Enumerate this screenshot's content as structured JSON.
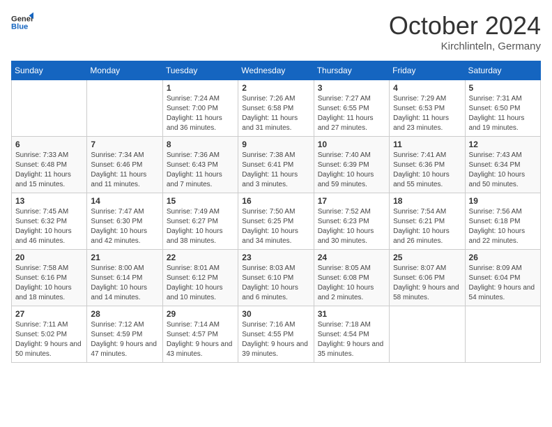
{
  "header": {
    "logo_general": "General",
    "logo_blue": "Blue",
    "month_title": "October 2024",
    "location": "Kirchlinteln, Germany"
  },
  "calendar": {
    "days_of_week": [
      "Sunday",
      "Monday",
      "Tuesday",
      "Wednesday",
      "Thursday",
      "Friday",
      "Saturday"
    ],
    "weeks": [
      [
        {
          "day": null,
          "sunrise": null,
          "sunset": null,
          "daylight": null
        },
        {
          "day": null,
          "sunrise": null,
          "sunset": null,
          "daylight": null
        },
        {
          "day": "1",
          "sunrise": "Sunrise: 7:24 AM",
          "sunset": "Sunset: 7:00 PM",
          "daylight": "Daylight: 11 hours and 36 minutes."
        },
        {
          "day": "2",
          "sunrise": "Sunrise: 7:26 AM",
          "sunset": "Sunset: 6:58 PM",
          "daylight": "Daylight: 11 hours and 31 minutes."
        },
        {
          "day": "3",
          "sunrise": "Sunrise: 7:27 AM",
          "sunset": "Sunset: 6:55 PM",
          "daylight": "Daylight: 11 hours and 27 minutes."
        },
        {
          "day": "4",
          "sunrise": "Sunrise: 7:29 AM",
          "sunset": "Sunset: 6:53 PM",
          "daylight": "Daylight: 11 hours and 23 minutes."
        },
        {
          "day": "5",
          "sunrise": "Sunrise: 7:31 AM",
          "sunset": "Sunset: 6:50 PM",
          "daylight": "Daylight: 11 hours and 19 minutes."
        }
      ],
      [
        {
          "day": "6",
          "sunrise": "Sunrise: 7:33 AM",
          "sunset": "Sunset: 6:48 PM",
          "daylight": "Daylight: 11 hours and 15 minutes."
        },
        {
          "day": "7",
          "sunrise": "Sunrise: 7:34 AM",
          "sunset": "Sunset: 6:46 PM",
          "daylight": "Daylight: 11 hours and 11 minutes."
        },
        {
          "day": "8",
          "sunrise": "Sunrise: 7:36 AM",
          "sunset": "Sunset: 6:43 PM",
          "daylight": "Daylight: 11 hours and 7 minutes."
        },
        {
          "day": "9",
          "sunrise": "Sunrise: 7:38 AM",
          "sunset": "Sunset: 6:41 PM",
          "daylight": "Daylight: 11 hours and 3 minutes."
        },
        {
          "day": "10",
          "sunrise": "Sunrise: 7:40 AM",
          "sunset": "Sunset: 6:39 PM",
          "daylight": "Daylight: 10 hours and 59 minutes."
        },
        {
          "day": "11",
          "sunrise": "Sunrise: 7:41 AM",
          "sunset": "Sunset: 6:36 PM",
          "daylight": "Daylight: 10 hours and 55 minutes."
        },
        {
          "day": "12",
          "sunrise": "Sunrise: 7:43 AM",
          "sunset": "Sunset: 6:34 PM",
          "daylight": "Daylight: 10 hours and 50 minutes."
        }
      ],
      [
        {
          "day": "13",
          "sunrise": "Sunrise: 7:45 AM",
          "sunset": "Sunset: 6:32 PM",
          "daylight": "Daylight: 10 hours and 46 minutes."
        },
        {
          "day": "14",
          "sunrise": "Sunrise: 7:47 AM",
          "sunset": "Sunset: 6:30 PM",
          "daylight": "Daylight: 10 hours and 42 minutes."
        },
        {
          "day": "15",
          "sunrise": "Sunrise: 7:49 AM",
          "sunset": "Sunset: 6:27 PM",
          "daylight": "Daylight: 10 hours and 38 minutes."
        },
        {
          "day": "16",
          "sunrise": "Sunrise: 7:50 AM",
          "sunset": "Sunset: 6:25 PM",
          "daylight": "Daylight: 10 hours and 34 minutes."
        },
        {
          "day": "17",
          "sunrise": "Sunrise: 7:52 AM",
          "sunset": "Sunset: 6:23 PM",
          "daylight": "Daylight: 10 hours and 30 minutes."
        },
        {
          "day": "18",
          "sunrise": "Sunrise: 7:54 AM",
          "sunset": "Sunset: 6:21 PM",
          "daylight": "Daylight: 10 hours and 26 minutes."
        },
        {
          "day": "19",
          "sunrise": "Sunrise: 7:56 AM",
          "sunset": "Sunset: 6:18 PM",
          "daylight": "Daylight: 10 hours and 22 minutes."
        }
      ],
      [
        {
          "day": "20",
          "sunrise": "Sunrise: 7:58 AM",
          "sunset": "Sunset: 6:16 PM",
          "daylight": "Daylight: 10 hours and 18 minutes."
        },
        {
          "day": "21",
          "sunrise": "Sunrise: 8:00 AM",
          "sunset": "Sunset: 6:14 PM",
          "daylight": "Daylight: 10 hours and 14 minutes."
        },
        {
          "day": "22",
          "sunrise": "Sunrise: 8:01 AM",
          "sunset": "Sunset: 6:12 PM",
          "daylight": "Daylight: 10 hours and 10 minutes."
        },
        {
          "day": "23",
          "sunrise": "Sunrise: 8:03 AM",
          "sunset": "Sunset: 6:10 PM",
          "daylight": "Daylight: 10 hours and 6 minutes."
        },
        {
          "day": "24",
          "sunrise": "Sunrise: 8:05 AM",
          "sunset": "Sunset: 6:08 PM",
          "daylight": "Daylight: 10 hours and 2 minutes."
        },
        {
          "day": "25",
          "sunrise": "Sunrise: 8:07 AM",
          "sunset": "Sunset: 6:06 PM",
          "daylight": "Daylight: 9 hours and 58 minutes."
        },
        {
          "day": "26",
          "sunrise": "Sunrise: 8:09 AM",
          "sunset": "Sunset: 6:04 PM",
          "daylight": "Daylight: 9 hours and 54 minutes."
        }
      ],
      [
        {
          "day": "27",
          "sunrise": "Sunrise: 7:11 AM",
          "sunset": "Sunset: 5:02 PM",
          "daylight": "Daylight: 9 hours and 50 minutes."
        },
        {
          "day": "28",
          "sunrise": "Sunrise: 7:12 AM",
          "sunset": "Sunset: 4:59 PM",
          "daylight": "Daylight: 9 hours and 47 minutes."
        },
        {
          "day": "29",
          "sunrise": "Sunrise: 7:14 AM",
          "sunset": "Sunset: 4:57 PM",
          "daylight": "Daylight: 9 hours and 43 minutes."
        },
        {
          "day": "30",
          "sunrise": "Sunrise: 7:16 AM",
          "sunset": "Sunset: 4:55 PM",
          "daylight": "Daylight: 9 hours and 39 minutes."
        },
        {
          "day": "31",
          "sunrise": "Sunrise: 7:18 AM",
          "sunset": "Sunset: 4:54 PM",
          "daylight": "Daylight: 9 hours and 35 minutes."
        },
        {
          "day": null,
          "sunrise": null,
          "sunset": null,
          "daylight": null
        },
        {
          "day": null,
          "sunrise": null,
          "sunset": null,
          "daylight": null
        }
      ]
    ]
  }
}
